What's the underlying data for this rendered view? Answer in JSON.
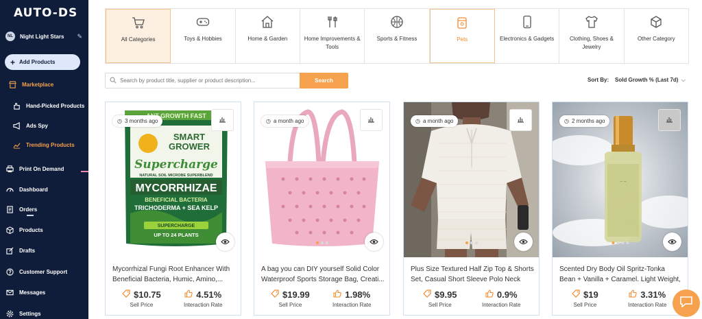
{
  "app": {
    "logo": "AUTO-DS"
  },
  "user": {
    "initials": "NL",
    "name": "Night Light Stars"
  },
  "sidebar": {
    "add_label": "Add Products",
    "items": [
      {
        "label": "Marketplace",
        "icon": "store-icon"
      },
      {
        "label": "Hand-Picked Products",
        "icon": "hand-icon"
      },
      {
        "label": "Ads Spy",
        "icon": "megaphone-icon"
      },
      {
        "label": "Trending Products",
        "icon": "trend-icon"
      },
      {
        "label": "Print On Demand",
        "icon": "print-icon"
      },
      {
        "label": "Dashboard",
        "icon": "dashboard-icon"
      },
      {
        "label": "Orders",
        "icon": "orders-icon"
      },
      {
        "label": "Products",
        "icon": "box-icon"
      },
      {
        "label": "Drafts",
        "icon": "drafts-icon"
      },
      {
        "label": "Customer Support",
        "icon": "support-icon"
      },
      {
        "label": "Messages",
        "icon": "mail-icon"
      },
      {
        "label": "Settings",
        "icon": "gear-icon"
      }
    ]
  },
  "categories": [
    {
      "label": "All Categories",
      "icon": "cart-icon"
    },
    {
      "label": "Toys & Hobbies",
      "icon": "gamepad-icon"
    },
    {
      "label": "Home & Garden",
      "icon": "house-icon"
    },
    {
      "label": "Home Improvements & Tools",
      "icon": "tools-icon"
    },
    {
      "label": "Sports & Fitness",
      "icon": "ball-icon"
    },
    {
      "label": "Pets",
      "icon": "pet-food-icon"
    },
    {
      "label": "Electronics & Gadgets",
      "icon": "phone-icon"
    },
    {
      "label": "Clothing, Shoes & Jewelry",
      "icon": "shirt-icon"
    },
    {
      "label": "Other Category",
      "icon": "cube-icon"
    }
  ],
  "search": {
    "placeholder": "Search by product title, supplier or product description...",
    "button": "Search"
  },
  "sort": {
    "label": "Sort By:",
    "value": "Sold Growth % (Last 7d)"
  },
  "products": [
    {
      "age": "3 months ago",
      "title": "Mycorrhizal Fungi Root Enhancer With Beneficial Bacteria, Humic, Amino,...",
      "price": "$10.75",
      "price_label": "Sell Price",
      "rate": "4.51%",
      "rate_label": "Interaction Rate",
      "pkg_banner": "ANT GROWTH FAST",
      "pkg_brand1": "SMART",
      "pkg_brand2": "GROWER",
      "pkg_brand3": "Supercharge",
      "pkg_line": "NATURAL SOIL MICROBE SUPERBLEND",
      "pkg_title": "MYCORRHIZAE",
      "pkg_sub1": "BENEFICIAL BACTERIA",
      "pkg_sub2": "TRICHODERMA + SEA KELP",
      "pkg_bottom1": "SUPERCHARGE",
      "pkg_bottom2": "UP TO 24 PLANTS"
    },
    {
      "age": "a month ago",
      "title": "A bag you can DIY yourself Solid Color Waterproof Sports Storage Bag, Creati...",
      "price": "$19.99",
      "price_label": "Sell Price",
      "rate": "1.98%",
      "rate_label": "Interaction Rate"
    },
    {
      "age": "a month ago",
      "title": "Plus Size Textured Half Zip Top & Shorts Set, Casual Short Sleeve Polo Neck To...",
      "price": "$9.95",
      "price_label": "Sell Price",
      "rate": "0.9%",
      "rate_label": "Interaction Rate"
    },
    {
      "age": "2 months ago",
      "title": "Scented Dry Body Oil Spritz-Tonka Bean + Vanilla + Caramel. Light Weight, Non...",
      "price": "$19",
      "price_label": "Sell Price",
      "rate": "3.31%",
      "rate_label": "Interaction Rate"
    }
  ],
  "colors": {
    "accent": "#f5a14d",
    "sidebar": "#0f1d3a",
    "card_border": "#cfe0f3"
  }
}
